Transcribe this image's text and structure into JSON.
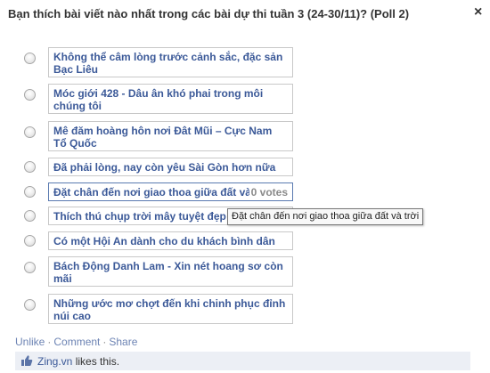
{
  "poll": {
    "question": "Bạn thích bài viết nào nhất trong các bài dự thi tuần 3 (24-30/11)? (Poll 2)",
    "close_label": "×",
    "options": [
      {
        "label": "Không thể câm lòng trước cảnh sắc, đặc sản Bạc Liêu"
      },
      {
        "label": "Móc giới 428 - Dâu ân khó phai trong môi chúng tôi"
      },
      {
        "label": "Mê đăm hoàng hôn nơi Đât Mũi – Cực Nam Tổ Quốc"
      },
      {
        "label": "Đã phải lòng, nay còn yêu Sài Gòn hơn nữa"
      },
      {
        "label": "Đặt chân đến nơi giao thoa giữa đất và trời",
        "votes": "0 votes"
      },
      {
        "label": "Thích thú chụp trời mây tuyệt đẹp"
      },
      {
        "label": "Có một Hội An dành cho du khách bình dân"
      },
      {
        "label": "Bách Động Danh Lam - Xin nét hoang sơ còn mãi"
      },
      {
        "label": "Những ước mơ chợt đến khi chinh phục đỉnh núi cao"
      }
    ],
    "tooltip": "Đặt chân đến nơi giao thoa giữa đất và trời"
  },
  "actions": {
    "unlike": "Unlike",
    "comment": "Comment",
    "share": "Share",
    "separator": "·"
  },
  "likes": {
    "page": "Zing.vn",
    "text": " likes this."
  },
  "colors": {
    "link": "#3b5998",
    "vote_count": "#8a8a8a",
    "likebar_bg": "#eceff5"
  },
  "icons": [
    "close-icon",
    "radio-icon",
    "thumbs-up-icon"
  ]
}
